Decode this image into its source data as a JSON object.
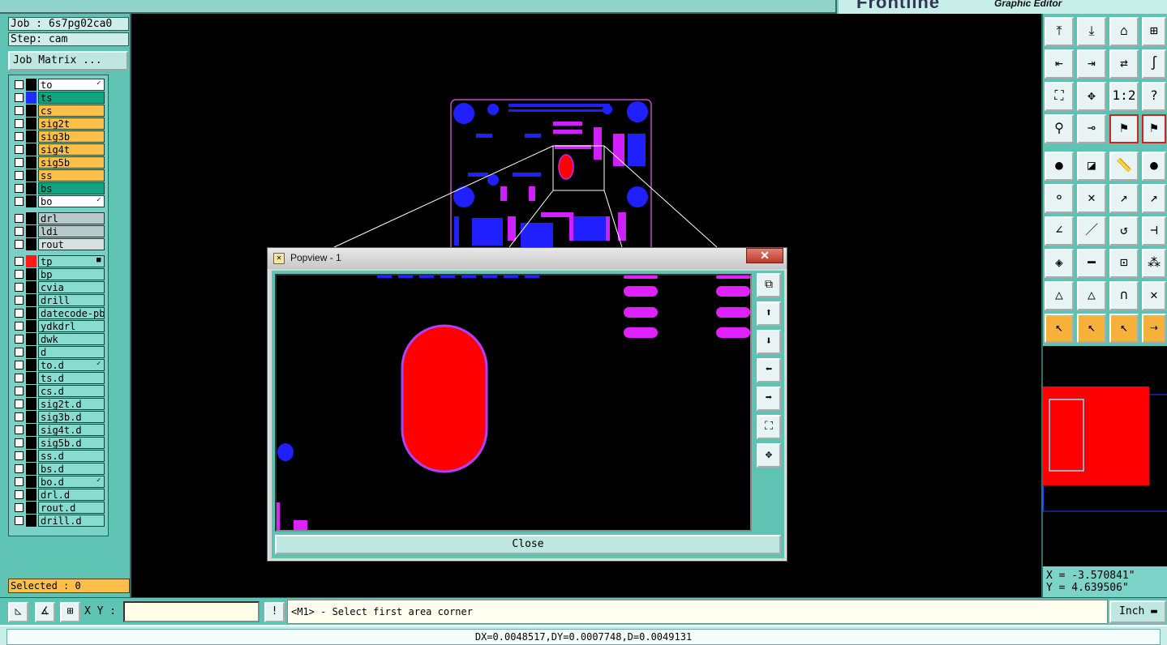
{
  "header": {
    "logo_text": "Frontline",
    "subtitle": "Graphic Editor"
  },
  "job": {
    "job_line": "Job : 6s7pg02ca0",
    "step_line": "Step: cam",
    "matrix_button": "Job Matrix ..."
  },
  "layers": [
    {
      "name": "to",
      "style": "white",
      "color": "#000000",
      "mark": "✓"
    },
    {
      "name": "ts",
      "style": "green",
      "color": "#1d2fff",
      "mark": ""
    },
    {
      "name": "cs",
      "style": "orange",
      "color": "#000000",
      "mark": ""
    },
    {
      "name": "sig2t",
      "style": "orange",
      "color": "#000000",
      "mark": ""
    },
    {
      "name": "sig3b",
      "style": "orange",
      "color": "#000000",
      "mark": ""
    },
    {
      "name": "sig4t",
      "style": "orange",
      "color": "#000000",
      "mark": ""
    },
    {
      "name": "sig5b",
      "style": "orange",
      "color": "#000000",
      "mark": ""
    },
    {
      "name": "ss",
      "style": "orange",
      "color": "#000000",
      "mark": ""
    },
    {
      "name": "bs",
      "style": "green",
      "color": "#000000",
      "mark": ""
    },
    {
      "name": "bo",
      "style": "white",
      "color": "#000000",
      "mark": "✓"
    },
    {
      "name": "drl",
      "style": "gray",
      "color": "#000000",
      "mark": ""
    },
    {
      "name": "ldi",
      "style": "gray",
      "color": "#000000",
      "mark": ""
    },
    {
      "name": "rout",
      "style": "lgray",
      "color": "#000000",
      "mark": ""
    },
    {
      "name": "tp",
      "style": "teal",
      "color": "#ff1a1a",
      "mark": "■"
    },
    {
      "name": "bp",
      "style": "teal",
      "color": "#000000",
      "mark": ""
    },
    {
      "name": "cvia",
      "style": "teal",
      "color": "#000000",
      "mark": ""
    },
    {
      "name": "drill",
      "style": "teal",
      "color": "#000000",
      "mark": ""
    },
    {
      "name": "datecode-pbo",
      "style": "teal",
      "color": "#000000",
      "mark": ""
    },
    {
      "name": "ydkdrl",
      "style": "teal",
      "color": "#000000",
      "mark": ""
    },
    {
      "name": "dwk",
      "style": "teal",
      "color": "#000000",
      "mark": ""
    },
    {
      "name": "d",
      "style": "teal",
      "color": "#000000",
      "mark": ""
    },
    {
      "name": "to.d",
      "style": "teal",
      "color": "#000000",
      "mark": "✓"
    },
    {
      "name": "ts.d",
      "style": "teal",
      "color": "#000000",
      "mark": ""
    },
    {
      "name": "cs.d",
      "style": "teal",
      "color": "#000000",
      "mark": ""
    },
    {
      "name": "sig2t.d",
      "style": "teal",
      "color": "#000000",
      "mark": ""
    },
    {
      "name": "sig3b.d",
      "style": "teal",
      "color": "#000000",
      "mark": ""
    },
    {
      "name": "sig4t.d",
      "style": "teal",
      "color": "#000000",
      "mark": ""
    },
    {
      "name": "sig5b.d",
      "style": "teal",
      "color": "#000000",
      "mark": ""
    },
    {
      "name": "ss.d",
      "style": "teal",
      "color": "#000000",
      "mark": ""
    },
    {
      "name": "bs.d",
      "style": "teal",
      "color": "#000000",
      "mark": ""
    },
    {
      "name": "bo.d",
      "style": "teal",
      "color": "#000000",
      "mark": "✓"
    },
    {
      "name": "drl.d",
      "style": "teal",
      "color": "#000000",
      "mark": ""
    },
    {
      "name": "rout.d",
      "style": "teal",
      "color": "#000000",
      "mark": ""
    },
    {
      "name": "drill.d",
      "style": "teal",
      "color": "#000000",
      "mark": ""
    }
  ],
  "selected": "Selected : 0",
  "popview": {
    "title": "Popview - 1",
    "close_x": "✕",
    "close_button": "Close"
  },
  "coords": {
    "x_line": "X = -3.570841\"",
    "y_line": "Y = 4.639506\""
  },
  "command": {
    "xy_label": "X Y :",
    "xy_value": "",
    "prompt": "<M1> - Select first area corner",
    "units": "Inch"
  },
  "status": "DX=0.0048517,DY=0.0007748,D=0.0049131",
  "colors": {
    "accent": "#5fc3b4",
    "pad_red": "#ff0000",
    "pad_blue": "#2020ff",
    "pad_magenta": "#e020ff",
    "highlight_orange": "#fdbf4a"
  },
  "tools": [
    "open-step-icon",
    "save-icon",
    "home-icon",
    "split-view-icon",
    "import-icon",
    "export-icon",
    "swap-icon",
    "snap-icon",
    "zoom-fit-icon",
    "zoom-center-icon",
    "scale-1-2-icon",
    "help-icon",
    "measure-probe-icon",
    "net-icon",
    "traffic-light-icon",
    "traffic-light-2-icon",
    "pad-select-icon",
    "feature-select-icon",
    "ruler-icon",
    "dot-icon",
    "node-link-icon",
    "cross-icon",
    "line-add-icon",
    "line-move-icon",
    "angle-icon",
    "draw-line-icon",
    "rotate-icon",
    "flip-icon",
    "pad-add-icon",
    "line-red-icon",
    "pad-resize-icon",
    "pads-icon",
    "fill-triangle-icon",
    "outline-triangle-icon",
    "arch-icon",
    "arch-cross-icon",
    "pointer-icon",
    "pointer-select-icon",
    "pointer-box-icon",
    "route-icon"
  ]
}
